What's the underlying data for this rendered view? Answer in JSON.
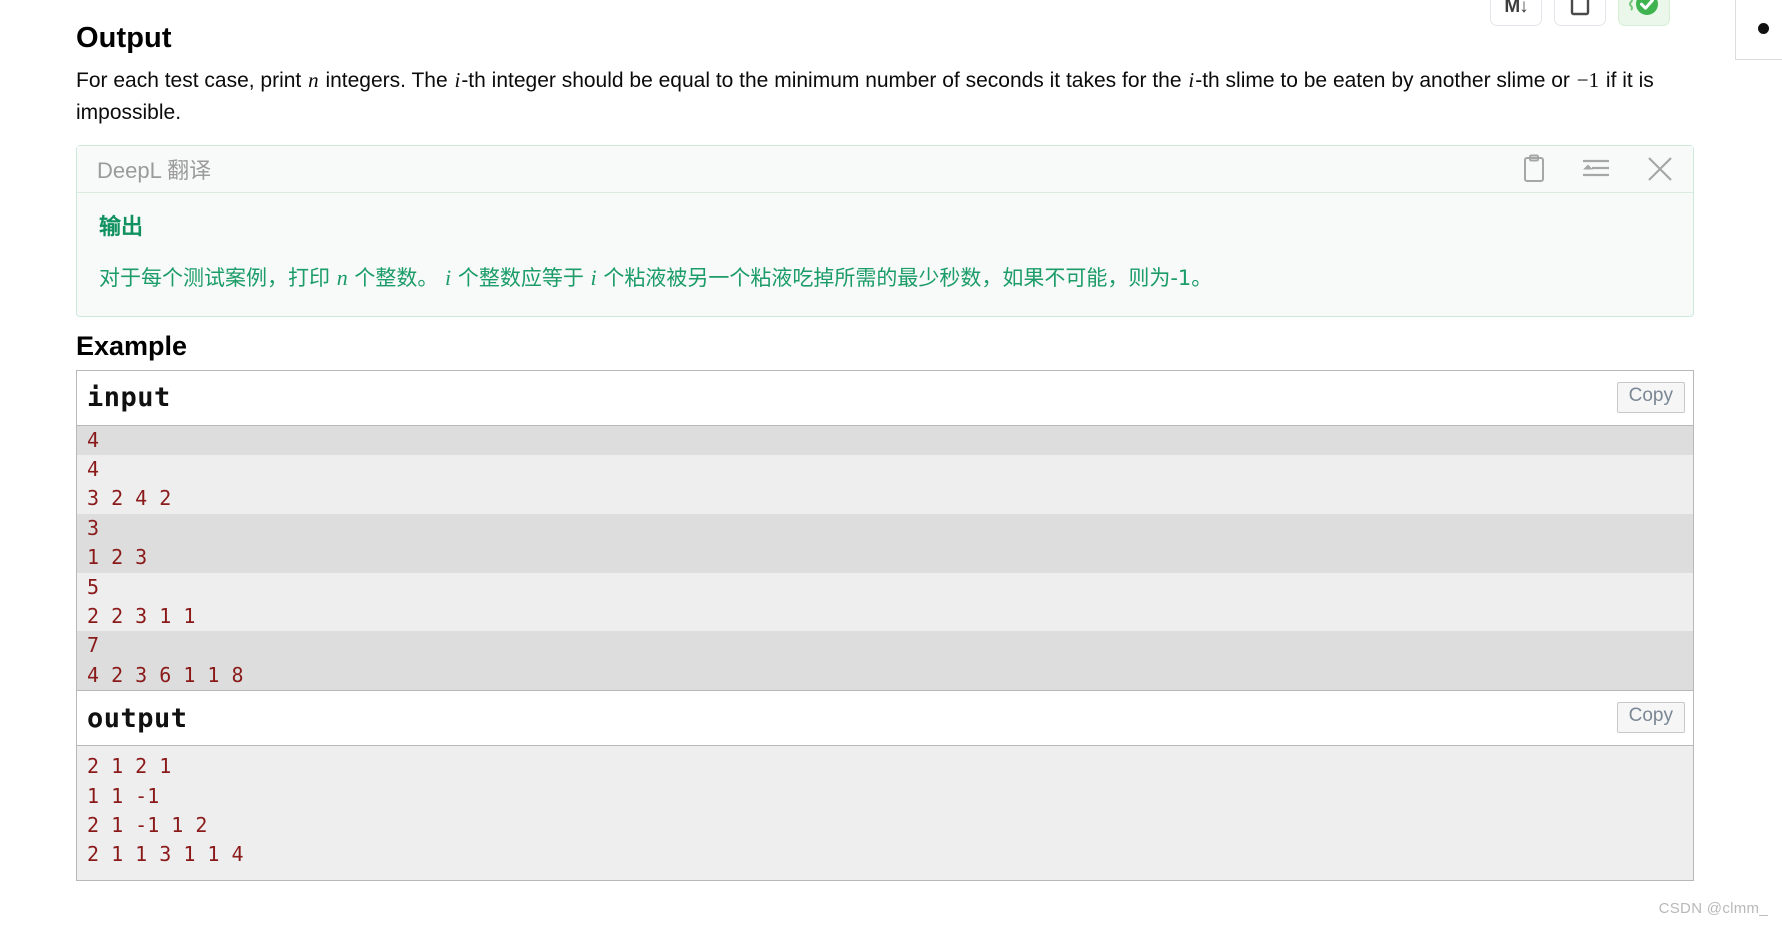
{
  "top_toolbar": {
    "buttons": [
      {
        "name": "markdown-download-button",
        "glyph": "M↓",
        "icon": "markdown-down-icon"
      },
      {
        "name": "page-outline-button",
        "glyph": "",
        "icon": "square-page-icon"
      },
      {
        "name": "verified-badge-button",
        "glyph": "",
        "icon": "green-check-circle-icon"
      }
    ]
  },
  "side_panel": {
    "visible": true
  },
  "section": {
    "heading": "Output",
    "statement": {
      "part1": "For each test case, print ",
      "var_n": "n",
      "part2": " integers. The ",
      "var_i1": "i",
      "part3": "-th integer should be equal to the minimum number of seconds it takes for the ",
      "var_i2": "i",
      "part4": "-th slime to be eaten by another slime or ",
      "num_neg1": "−1",
      "part5": " if it is impossible."
    }
  },
  "deepl": {
    "title": "DeepL 翻译",
    "actions": [
      {
        "name": "copy-translation-icon",
        "icon": "clipboard-icon"
      },
      {
        "name": "format-translation-icon",
        "icon": "align-indent-icon"
      },
      {
        "name": "close-translation-icon",
        "icon": "close-x-icon"
      }
    ],
    "heading": "输出",
    "body": {
      "seg1": "对于每个测试案例，打印 ",
      "var_n": "n",
      "seg2": " 个整数。 ",
      "var_i1": "i",
      "seg3": " 个整数应等于 ",
      "var_i2": "i",
      "seg4": " 个粘液被另一个粘液吃掉所需的最少秒数，如果不可能，则为-1。"
    },
    "border_color": "#cde9da",
    "text_color": "#1b9c68"
  },
  "example": {
    "heading": "Example",
    "input": {
      "label": "input",
      "copy_label": "Copy",
      "lines": [
        {
          "text": "4",
          "shade": "dark"
        },
        {
          "text": "4",
          "shade": "light"
        },
        {
          "text": "3 2 4 2",
          "shade": "light"
        },
        {
          "text": "3",
          "shade": "dark"
        },
        {
          "text": "1 2 3",
          "shade": "dark"
        },
        {
          "text": "5",
          "shade": "light"
        },
        {
          "text": "2 2 3 1 1",
          "shade": "light"
        },
        {
          "text": "7",
          "shade": "dark"
        },
        {
          "text": "4 2 3 6 1 1 8",
          "shade": "dark"
        }
      ]
    },
    "output": {
      "label": "output",
      "copy_label": "Copy",
      "lines": [
        {
          "text": "2 1 2 1"
        },
        {
          "text": "1 1 -1"
        },
        {
          "text": "2 1 -1 1 2"
        },
        {
          "text": "2 1 1 3 1 1 4"
        }
      ]
    },
    "code_text_color": "#8a1a1a"
  },
  "watermark": {
    "text": "CSDN @clmm_"
  }
}
